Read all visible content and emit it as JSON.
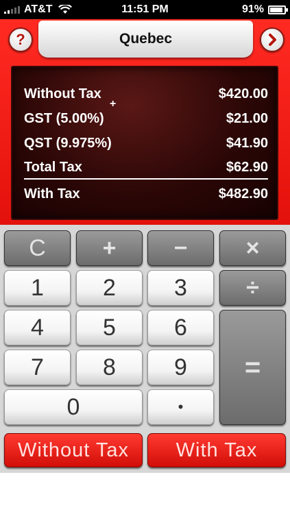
{
  "status_bar": {
    "carrier": "AT&T",
    "time": "11:51 PM",
    "battery": "91%"
  },
  "header": {
    "help_label": "?",
    "title": "Quebec",
    "next_label": "›"
  },
  "display": {
    "plus_mark": "+",
    "rows": [
      {
        "label": "Without Tax",
        "value": "$420.00"
      },
      {
        "label": "GST (5.00%)",
        "value": "$21.00"
      },
      {
        "label": "QST (9.975%)",
        "value": "$41.90"
      },
      {
        "label": "Total Tax",
        "value": "$62.90"
      },
      {
        "label": "With Tax",
        "value": "$482.90"
      }
    ]
  },
  "keypad": {
    "clear": "C",
    "plus": "+",
    "minus": "−",
    "multiply": "×",
    "divide": "÷",
    "equals": "=",
    "digits": [
      "0",
      "1",
      "2",
      "3",
      "4",
      "5",
      "6",
      "7",
      "8",
      "9"
    ],
    "decimal": "•",
    "without_tax": "Without Tax",
    "with_tax": "With Tax"
  }
}
